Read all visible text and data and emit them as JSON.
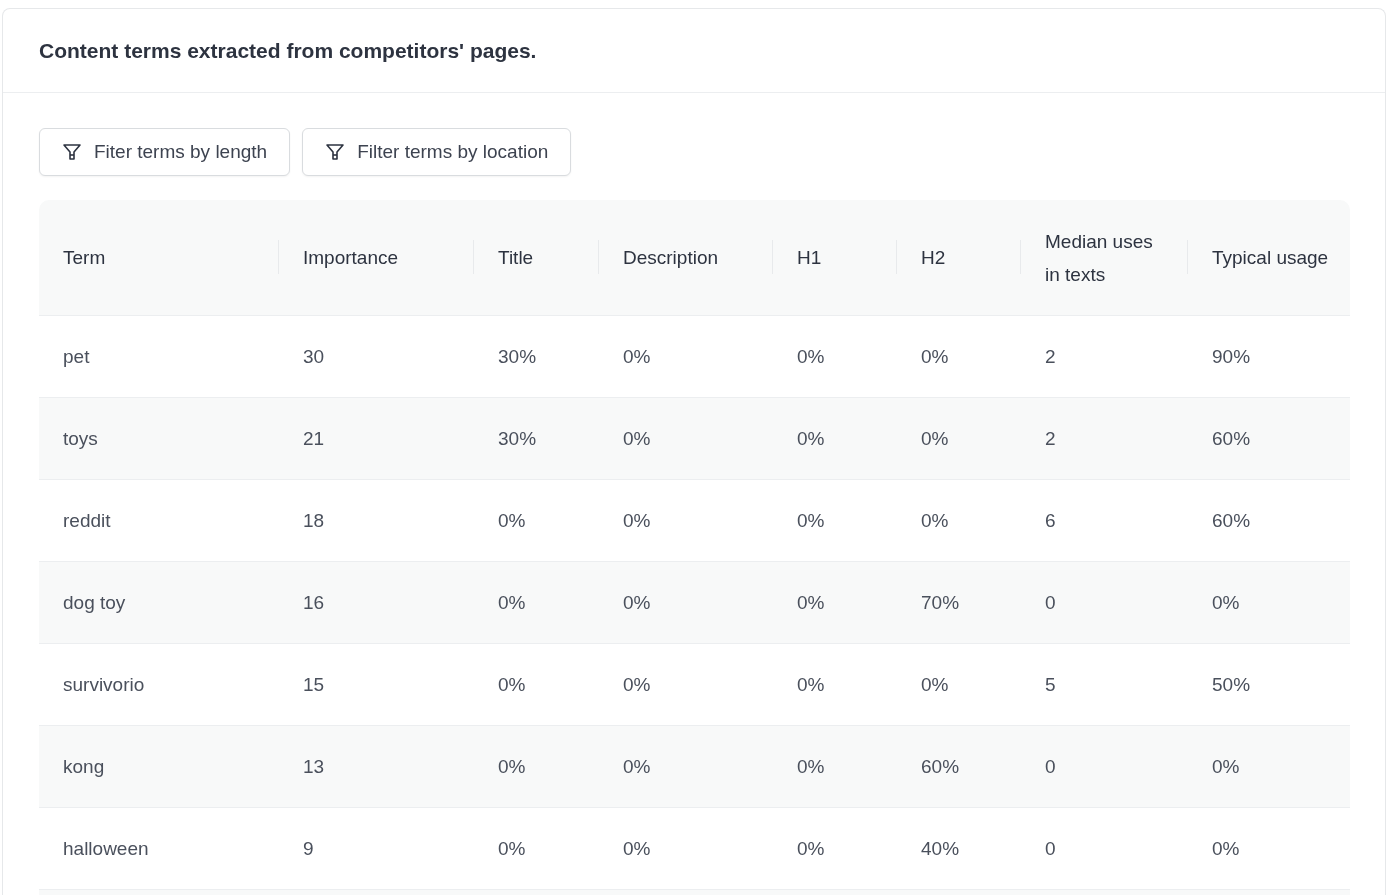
{
  "card": {
    "title": "Content terms extracted from competitors' pages."
  },
  "filters": [
    {
      "label": "Fiter terms by length"
    },
    {
      "label": "Filter terms by location"
    }
  ],
  "table": {
    "columns": [
      "Term",
      "Importance",
      "Title",
      "Description",
      "H1",
      "H2",
      "Median uses in texts",
      "Typical usage"
    ],
    "rows": [
      [
        "pet",
        "30",
        "30%",
        "0%",
        "0%",
        "0%",
        "2",
        "90%"
      ],
      [
        "toys",
        "21",
        "30%",
        "0%",
        "0%",
        "0%",
        "2",
        "60%"
      ],
      [
        "reddit",
        "18",
        "0%",
        "0%",
        "0%",
        "0%",
        "6",
        "60%"
      ],
      [
        "dog toy",
        "16",
        "0%",
        "0%",
        "0%",
        "70%",
        "0",
        "0%"
      ],
      [
        "survivorio",
        "15",
        "0%",
        "0%",
        "0%",
        "0%",
        "5",
        "50%"
      ],
      [
        "kong",
        "13",
        "0%",
        "0%",
        "0%",
        "60%",
        "0",
        "0%"
      ],
      [
        "halloween",
        "9",
        "0%",
        "0%",
        "0%",
        "40%",
        "0",
        "0%"
      ]
    ]
  }
}
